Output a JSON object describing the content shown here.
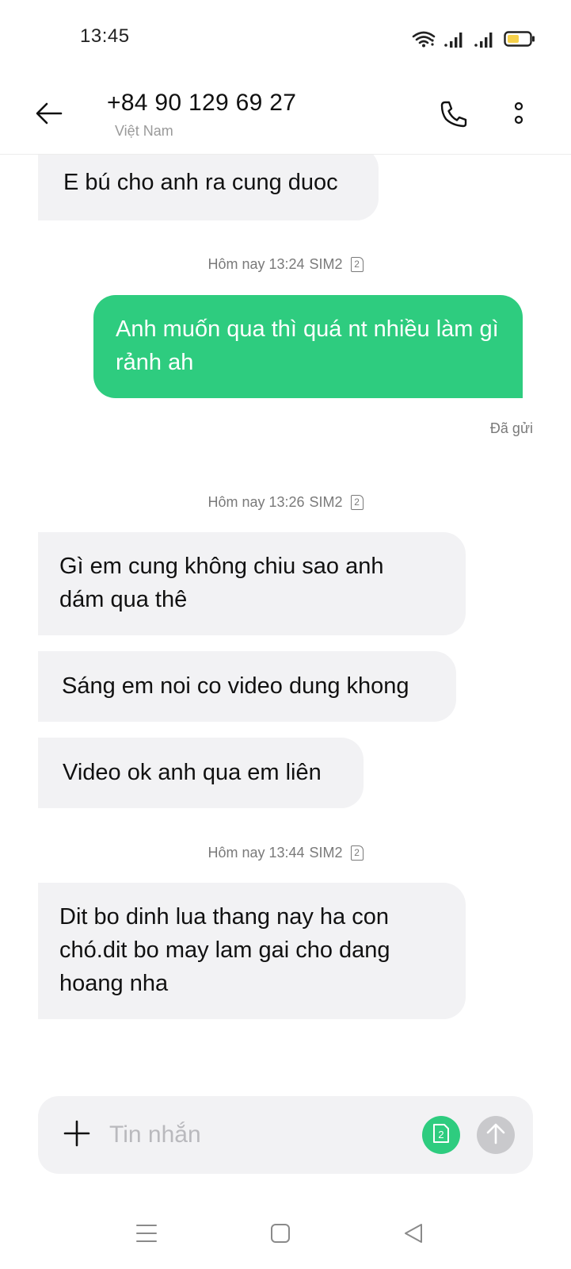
{
  "status_bar": {
    "time": "13:45",
    "icons": [
      "wifi-icon",
      "signal-sim1-icon",
      "signal-sim2-icon",
      "battery-icon"
    ]
  },
  "header": {
    "contact_number": "+84 90 129 69 27",
    "contact_country": "Việt Nam",
    "icons": [
      "back-arrow-icon",
      "phone-icon",
      "more-vertical-icon"
    ]
  },
  "conversation": {
    "messages": [
      {
        "direction": "incoming",
        "text": "E bú cho anh ra cung duoc"
      },
      {
        "direction": "outgoing",
        "text": "Anh muốn qua thì quá nt nhiều làm gì rảnh ah",
        "status": "Đã gửi"
      },
      {
        "direction": "incoming",
        "text": "Gì em cung không chiu sao anh dám qua thê"
      },
      {
        "direction": "incoming",
        "text": "Sáng em noi co video dung khong"
      },
      {
        "direction": "incoming",
        "text": "Video ok anh qua em liên"
      },
      {
        "direction": "incoming",
        "text": "Dit bo dinh lua thang nay ha con chó.dit bo may lam gai cho dang hoang nha"
      }
    ],
    "timestamps": [
      {
        "label": "Hôm nay 13:24",
        "sim": "SIM2",
        "sim_badge": "2"
      },
      {
        "label": "Hôm nay 13:26",
        "sim": "SIM2",
        "sim_badge": "2"
      },
      {
        "label": "Hôm nay 13:44",
        "sim": "SIM2",
        "sim_badge": "2"
      }
    ]
  },
  "composer": {
    "placeholder": "Tin nhắn",
    "value": "",
    "sim_button_label": "2",
    "accent_color": "#2ecc7f",
    "send_disabled_color": "#c9c9cc"
  },
  "colors": {
    "outgoing_bubble": "#2ecc7f",
    "incoming_bubble": "#f2f2f4",
    "battery_fill": "#f5d04a"
  },
  "nav_bar": {
    "icons": [
      "menu-icon",
      "home-square-icon",
      "back-triangle-icon"
    ]
  }
}
